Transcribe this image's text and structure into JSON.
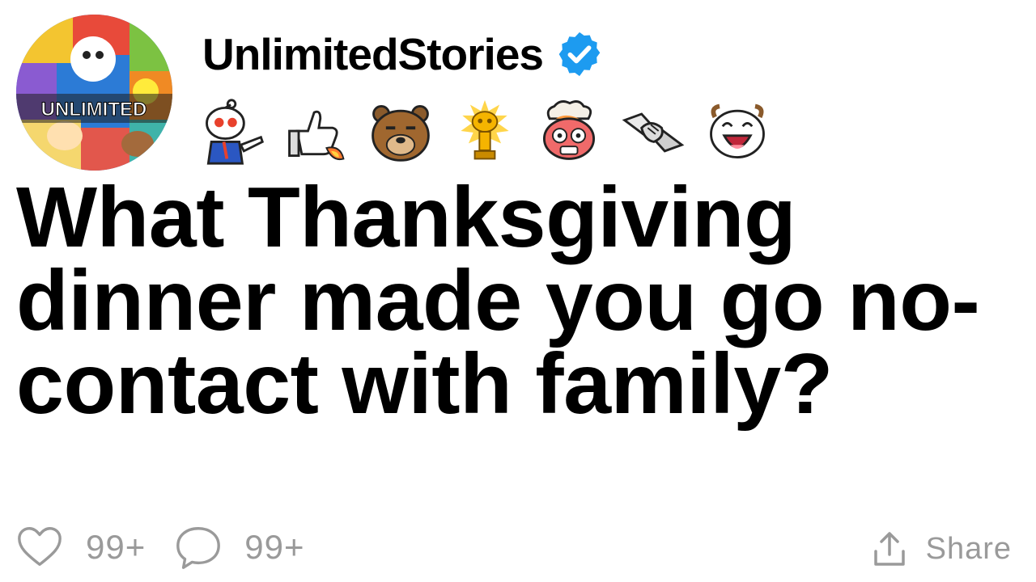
{
  "post": {
    "author": {
      "name": "UnlimitedStories",
      "verified": true,
      "avatar_text": "UNLIMITED"
    },
    "awards": [
      {
        "icon": "snoo-pointing-award-icon"
      },
      {
        "icon": "thumbs-up-rocket-award-icon"
      },
      {
        "icon": "bear-face-award-icon"
      },
      {
        "icon": "gold-trophy-snoo-award-icon"
      },
      {
        "icon": "mind-blown-award-icon"
      },
      {
        "icon": "handshake-award-icon"
      },
      {
        "icon": "laughing-snoo-award-icon"
      }
    ],
    "title": "What Thanksgiving dinner made you go no-contact with family?",
    "likes": "99+",
    "comments": "99+",
    "share_label": "Share"
  },
  "colors": {
    "verified_blue": "#1d9bf0",
    "muted_gray": "#9a9a9a"
  }
}
